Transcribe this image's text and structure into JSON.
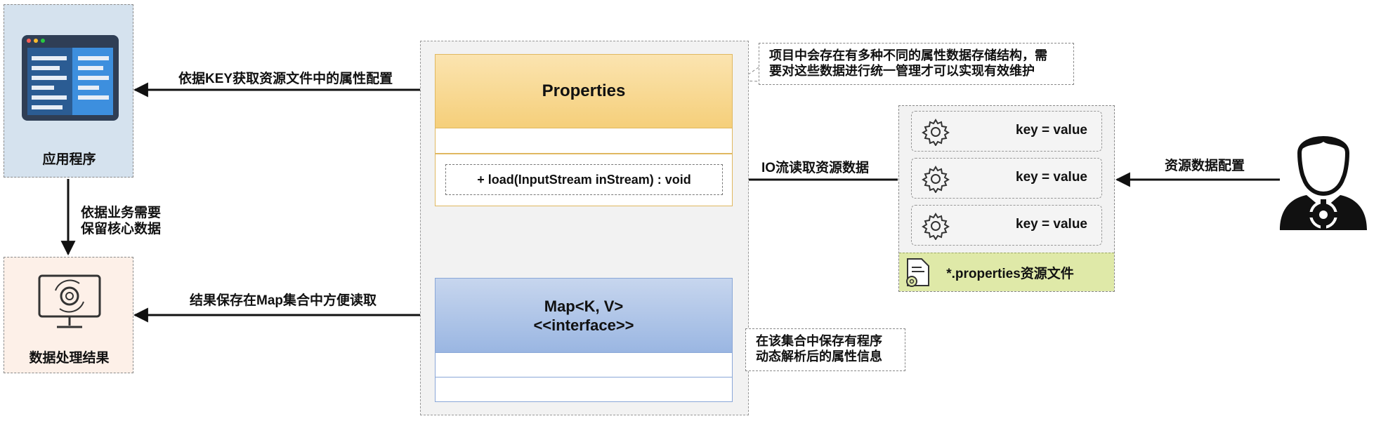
{
  "nodes": {
    "app": "应用程序",
    "result": "数据处理结果",
    "properties": "Properties",
    "method": "+ load(InputStream inStream) : void",
    "map_line1": "Map<K, V>",
    "map_line2": "<<interface>>",
    "kv": [
      "key = value",
      "key = value",
      "key = value"
    ],
    "file": "*.properties资源文件"
  },
  "edges": {
    "app_props": "依据KEY获取资源文件中的属性配置",
    "app_result_1": "依据业务需要",
    "app_result_2": "保留核心数据",
    "result_map": "结果保存在Map集合中方便读取",
    "file_method": "IO流读取资源数据",
    "user_file": "资源数据配置"
  },
  "notes": {
    "top_1": "项目中会存在有多种不同的属性数据存储结构，需",
    "top_2": "要对这些数据进行统一管理才可以实现有效维护",
    "bottom_1": "在该集合中保存有程序",
    "bottom_2": "动态解析后的属性信息"
  },
  "colors": {
    "properties": "#f5cf7a",
    "map": "#9ab6e2",
    "file_label": "#dfe9a8",
    "app_box": "#d5e2ee",
    "result_box": "#fdf0e8"
  }
}
